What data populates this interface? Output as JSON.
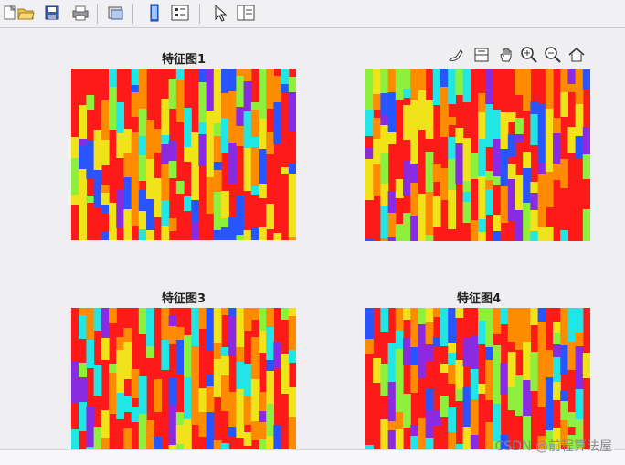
{
  "toolbar": {
    "icons": [
      "new-figure-icon",
      "open-file-icon",
      "save-icon",
      "print-icon",
      "print-preview-icon",
      "colorbar-icon",
      "legend-icon",
      "pointer-icon",
      "property-editor-icon"
    ]
  },
  "axes_toolbar": {
    "icons": [
      "brush-icon",
      "data-tip-icon",
      "pan-icon",
      "zoom-in-icon",
      "zoom-out-icon",
      "home-icon"
    ]
  },
  "subplots": {
    "t1": "特征图1",
    "t2": "",
    "t3": "特征图3",
    "t4": "特征图4"
  },
  "palette": {
    "red": "#ff1a1a",
    "orange": "#ff8c00",
    "yellow": "#f0e31a",
    "green": "#8df03c",
    "cyan": "#22e6e6",
    "blue": "#2855ff",
    "violet": "#8a2be2"
  },
  "watermark": "CSDN @前程算法屋"
}
